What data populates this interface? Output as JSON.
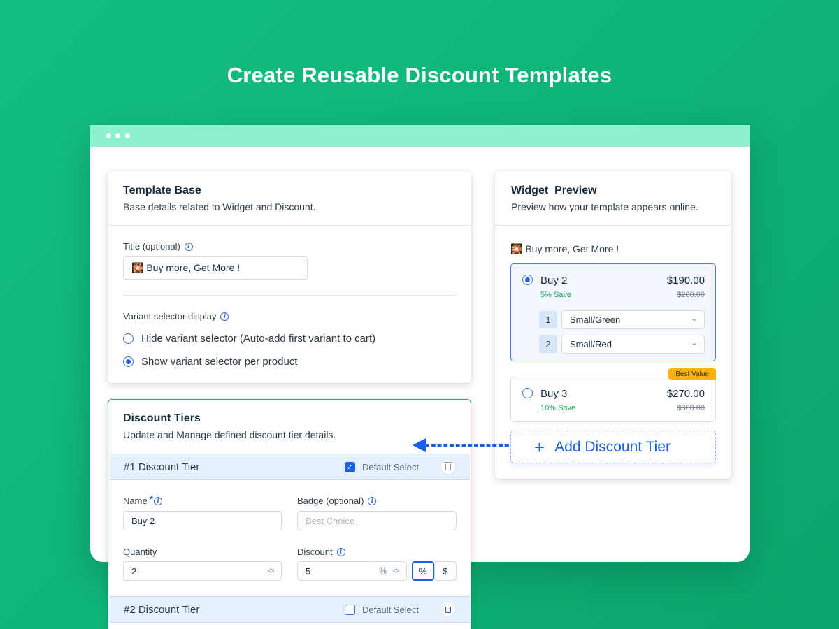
{
  "hero": {
    "title": "Create Reusable Discount Templates"
  },
  "template_base": {
    "title": "Template Base",
    "subtitle": "Base details related to Widget and Discount.",
    "title_field": {
      "label": "Title (optional)",
      "value": "🎇 Buy more, Get More !"
    },
    "variant": {
      "label": "Variant selector display",
      "options": [
        {
          "label": "Hide variant selector (Auto-add first variant to cart)",
          "selected": false
        },
        {
          "label": "Show variant selector per product",
          "selected": true
        }
      ]
    }
  },
  "discount_tiers": {
    "title": "Discount Tiers",
    "subtitle": "Update and Manage defined discount tier details.",
    "tiers": [
      {
        "header": "#1 Discount Tier",
        "default_label": "Default Select",
        "default_checked": true,
        "name_label": "Name",
        "required_mark": "*",
        "name_value": "Buy 2",
        "badge_label": "Badge (optional)",
        "badge_placeholder": "Best Choice",
        "quantity_label": "Quantity",
        "quantity_value": "2",
        "discount_label": "Discount",
        "discount_value": "5",
        "discount_unit": "%",
        "unit_percent": "%",
        "unit_dollar": "$"
      },
      {
        "header": "#2 Discount Tier",
        "default_label": "Default Select",
        "default_checked": false
      }
    ]
  },
  "preview": {
    "title": "Widget  Preview",
    "subtitle": "Preview how your template appears online.",
    "widget_title": "🎇 Buy more, Get More !",
    "offers": [
      {
        "name": "Buy 2",
        "price": "$190.00",
        "save": "5% Save",
        "old_price": "$200.00",
        "selected": true,
        "variants": [
          {
            "num": "1",
            "value": "Small/Green"
          },
          {
            "num": "2",
            "value": "Small/Red"
          }
        ]
      },
      {
        "name": "Buy 3",
        "price": "$270.00",
        "save": "10% Save",
        "old_price": "$300.00",
        "selected": false,
        "badge": "Best Value"
      }
    ],
    "add_tier": {
      "plus": "+",
      "label": "Add Discount Tier"
    }
  },
  "colors": {
    "accent": "#1a5fe8",
    "brand_green": "#0fb578",
    "window_bar": "#8bf2cd",
    "badge": "#fdb10b",
    "save_green": "#18a55a"
  },
  "icons": [
    "info-icon",
    "trash-icon",
    "chevron-down-icon",
    "stepper-icon",
    "plus-icon",
    "arrow-left-icon"
  ]
}
